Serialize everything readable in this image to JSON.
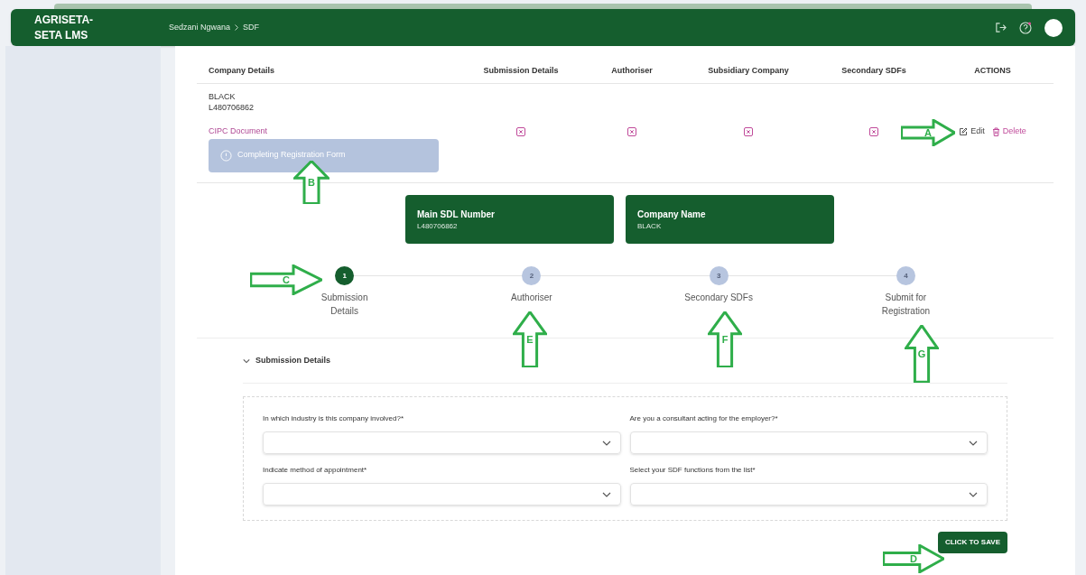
{
  "header": {
    "brand": "AGRISETA-SETA LMS",
    "breadcrumb": [
      "Sedzani Ngwana",
      "SDF"
    ]
  },
  "table": {
    "columns": [
      "Company Details",
      "Submission Details",
      "Authoriser",
      "Subsidiary Company",
      "Secondary SDFs",
      "ACTIONS"
    ],
    "row": {
      "company_name": "BLACK",
      "sdl_number": "L480706862",
      "document_link": "CIPC Document",
      "status": "Completing Registration Form",
      "actions": [
        "Edit",
        "Delete"
      ]
    }
  },
  "cards": [
    {
      "title": "Main SDL Number",
      "value": "L480706862"
    },
    {
      "title": "Company Name",
      "value": "BLACK"
    }
  ],
  "steps": [
    {
      "number": "1",
      "label": "Submission Details",
      "selected": true
    },
    {
      "number": "2",
      "label": "Authoriser",
      "selected": false
    },
    {
      "number": "3",
      "label": "Secondary SDFs",
      "selected": false
    },
    {
      "number": "4",
      "label": "Submit for Registration",
      "selected": false
    }
  ],
  "section": {
    "title": "Submission Details",
    "expanded": true,
    "fields": [
      {
        "label": "In which industry is this company involved?*"
      },
      {
        "label": "Are you a consultant acting for the employer?*"
      },
      {
        "label": "Indicate method of appointment*"
      },
      {
        "label": "Select your SDF functions from the list*"
      }
    ]
  },
  "save_button": "CLICK TO SAVE",
  "annotations": [
    {
      "label": "A",
      "kind": "right"
    },
    {
      "label": "B",
      "kind": "up"
    },
    {
      "label": "C",
      "kind": "right"
    },
    {
      "label": "D",
      "kind": "right"
    },
    {
      "label": "E",
      "kind": "up"
    },
    {
      "label": "F",
      "kind": "up"
    },
    {
      "label": "G",
      "kind": "up"
    }
  ]
}
